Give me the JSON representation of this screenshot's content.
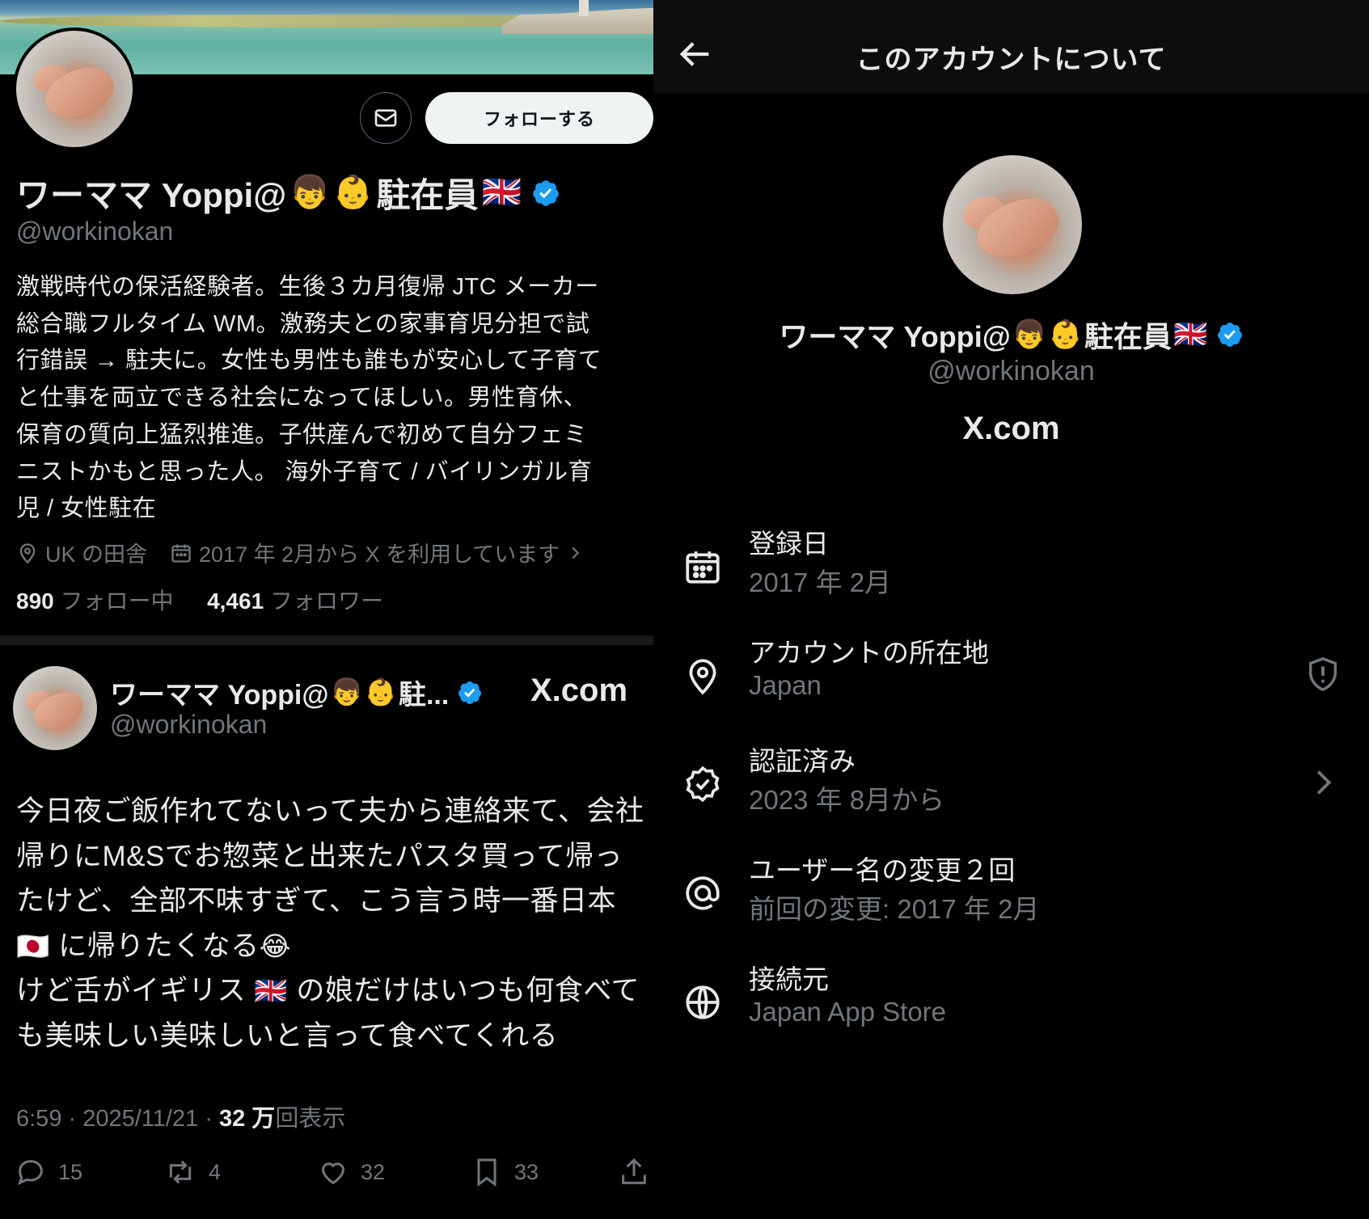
{
  "profile": {
    "display_name": "ワーママ Yoppi@",
    "name_suffix": "駐在員",
    "emoji_1": "👦",
    "emoji_2": "👶",
    "flag": "🇬🇧",
    "handle": "@workinokan",
    "follow_label": "フォローする",
    "bio_lines": [
      "激戦時代の保活経験者。生後３カ月復帰 JTC メーカー",
      "総合職フルタイム WM。激務夫との家事育児分担で試",
      "行錯誤 → 駐夫に。女性も男性も誰もが安心して子育て",
      "と仕事を両立できる社会になってほしい。男性育休、",
      "保育の質向上猛烈推進。子供産んで初めて自分フェミ",
      "ニストかもと思った人。 海外子育て / バイリンガル育",
      "児 / 女性駐在"
    ],
    "location": "UK の田舎",
    "joined": "2017 年 2月から X を利用しています",
    "following_count": "890",
    "following_label": "フォロー中",
    "followers_count": "4,461",
    "followers_label": "フォロワー"
  },
  "tweet": {
    "name": "ワーママ Yoppi@",
    "name_truncated": "駐...",
    "handle": "@workinokan",
    "xcom": "X.com",
    "text_lines": [
      "今日夜ご飯作れてないって夫から連絡来て、会社",
      "帰りにM&Sでお惣菜と出来たパスタ買って帰っ",
      "たけど、全部不味すぎて、こう言う時一番日本",
      "に帰りたくなる",
      "けど舌がイギリス",
      "の娘だけはいつも何食べて",
      "も美味しい美味しいと言って食べてくれる"
    ],
    "emoji_jp_flag": "🇯🇵",
    "emoji_laugh": "😂",
    "time": "6:59 · 2025/11/21 · ",
    "views_count": "32 万",
    "views_label": "回表示",
    "replies": "15",
    "retweets": "4",
    "likes": "32",
    "bookmarks": "33"
  },
  "about": {
    "title": "このアカウントについて",
    "name": "ワーママ Yoppi@",
    "name_suffix": "駐在員",
    "handle": "@workinokan",
    "xcom": "X.com",
    "rows": [
      {
        "label": "登録日",
        "value": "2017 年 2月",
        "icon": "calendar-icon"
      },
      {
        "label": "アカウントの所在地",
        "value": "Japan",
        "icon": "location-icon"
      },
      {
        "label": "認証済み",
        "value": "2023 年 8月から",
        "icon": "verified-badge-icon"
      },
      {
        "label": "ユーザー名の変更２回",
        "value": "前回の変更: 2017 年 2月",
        "icon": "at-icon"
      },
      {
        "label": "接続元",
        "value": "Japan App Store",
        "icon": "globe-icon"
      }
    ]
  },
  "colors": {
    "background": "#000000",
    "text_primary": "#e7e9ea",
    "text_secondary": "#71767b",
    "verified_blue": "#1d9bf0",
    "follow_button_bg": "#eff3f4"
  }
}
